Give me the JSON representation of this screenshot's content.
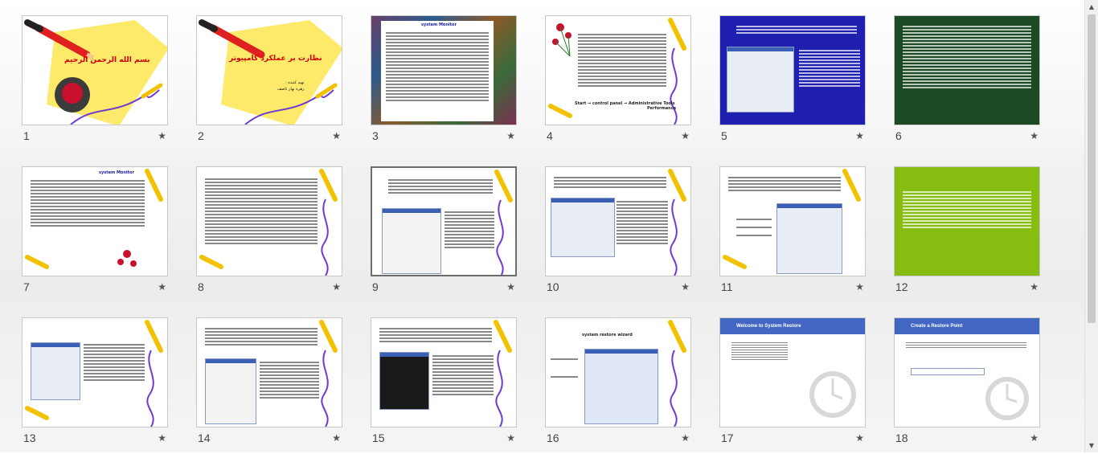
{
  "slides": [
    {
      "number": "1",
      "title": "بسم الله الرحمن الرحيم"
    },
    {
      "number": "2",
      "title": "نظارت بر عملکرد کامپیوتر",
      "subtitle": "تهیه کننده :",
      "subtitle2": "زهره بهار ناصف"
    },
    {
      "number": "3",
      "heading": "system Monitor"
    },
    {
      "number": "4",
      "label1": "Start",
      "label2": "control panel",
      "label3": "Administrative Tools",
      "label4": "Performance"
    },
    {
      "number": "5"
    },
    {
      "number": "6"
    },
    {
      "number": "7",
      "heading": "system Monitor"
    },
    {
      "number": "8"
    },
    {
      "number": "9"
    },
    {
      "number": "10"
    },
    {
      "number": "11"
    },
    {
      "number": "12"
    },
    {
      "number": "13"
    },
    {
      "number": "14"
    },
    {
      "number": "15"
    },
    {
      "number": "16",
      "heading": "system restore wizard"
    },
    {
      "number": "17",
      "title": "Welcome to System Restore"
    },
    {
      "number": "18",
      "title": "Create a Restore Point"
    }
  ],
  "star_glyph": "★",
  "scroll": {
    "up": "▲",
    "down": "▼"
  },
  "colors": {
    "accent": "#d00000",
    "slide5_bg": "#1f1fb0",
    "slide6_bg": "#1c4a24",
    "slide12_bg": "#86bd10",
    "wizard_bar": "#4266c2"
  }
}
